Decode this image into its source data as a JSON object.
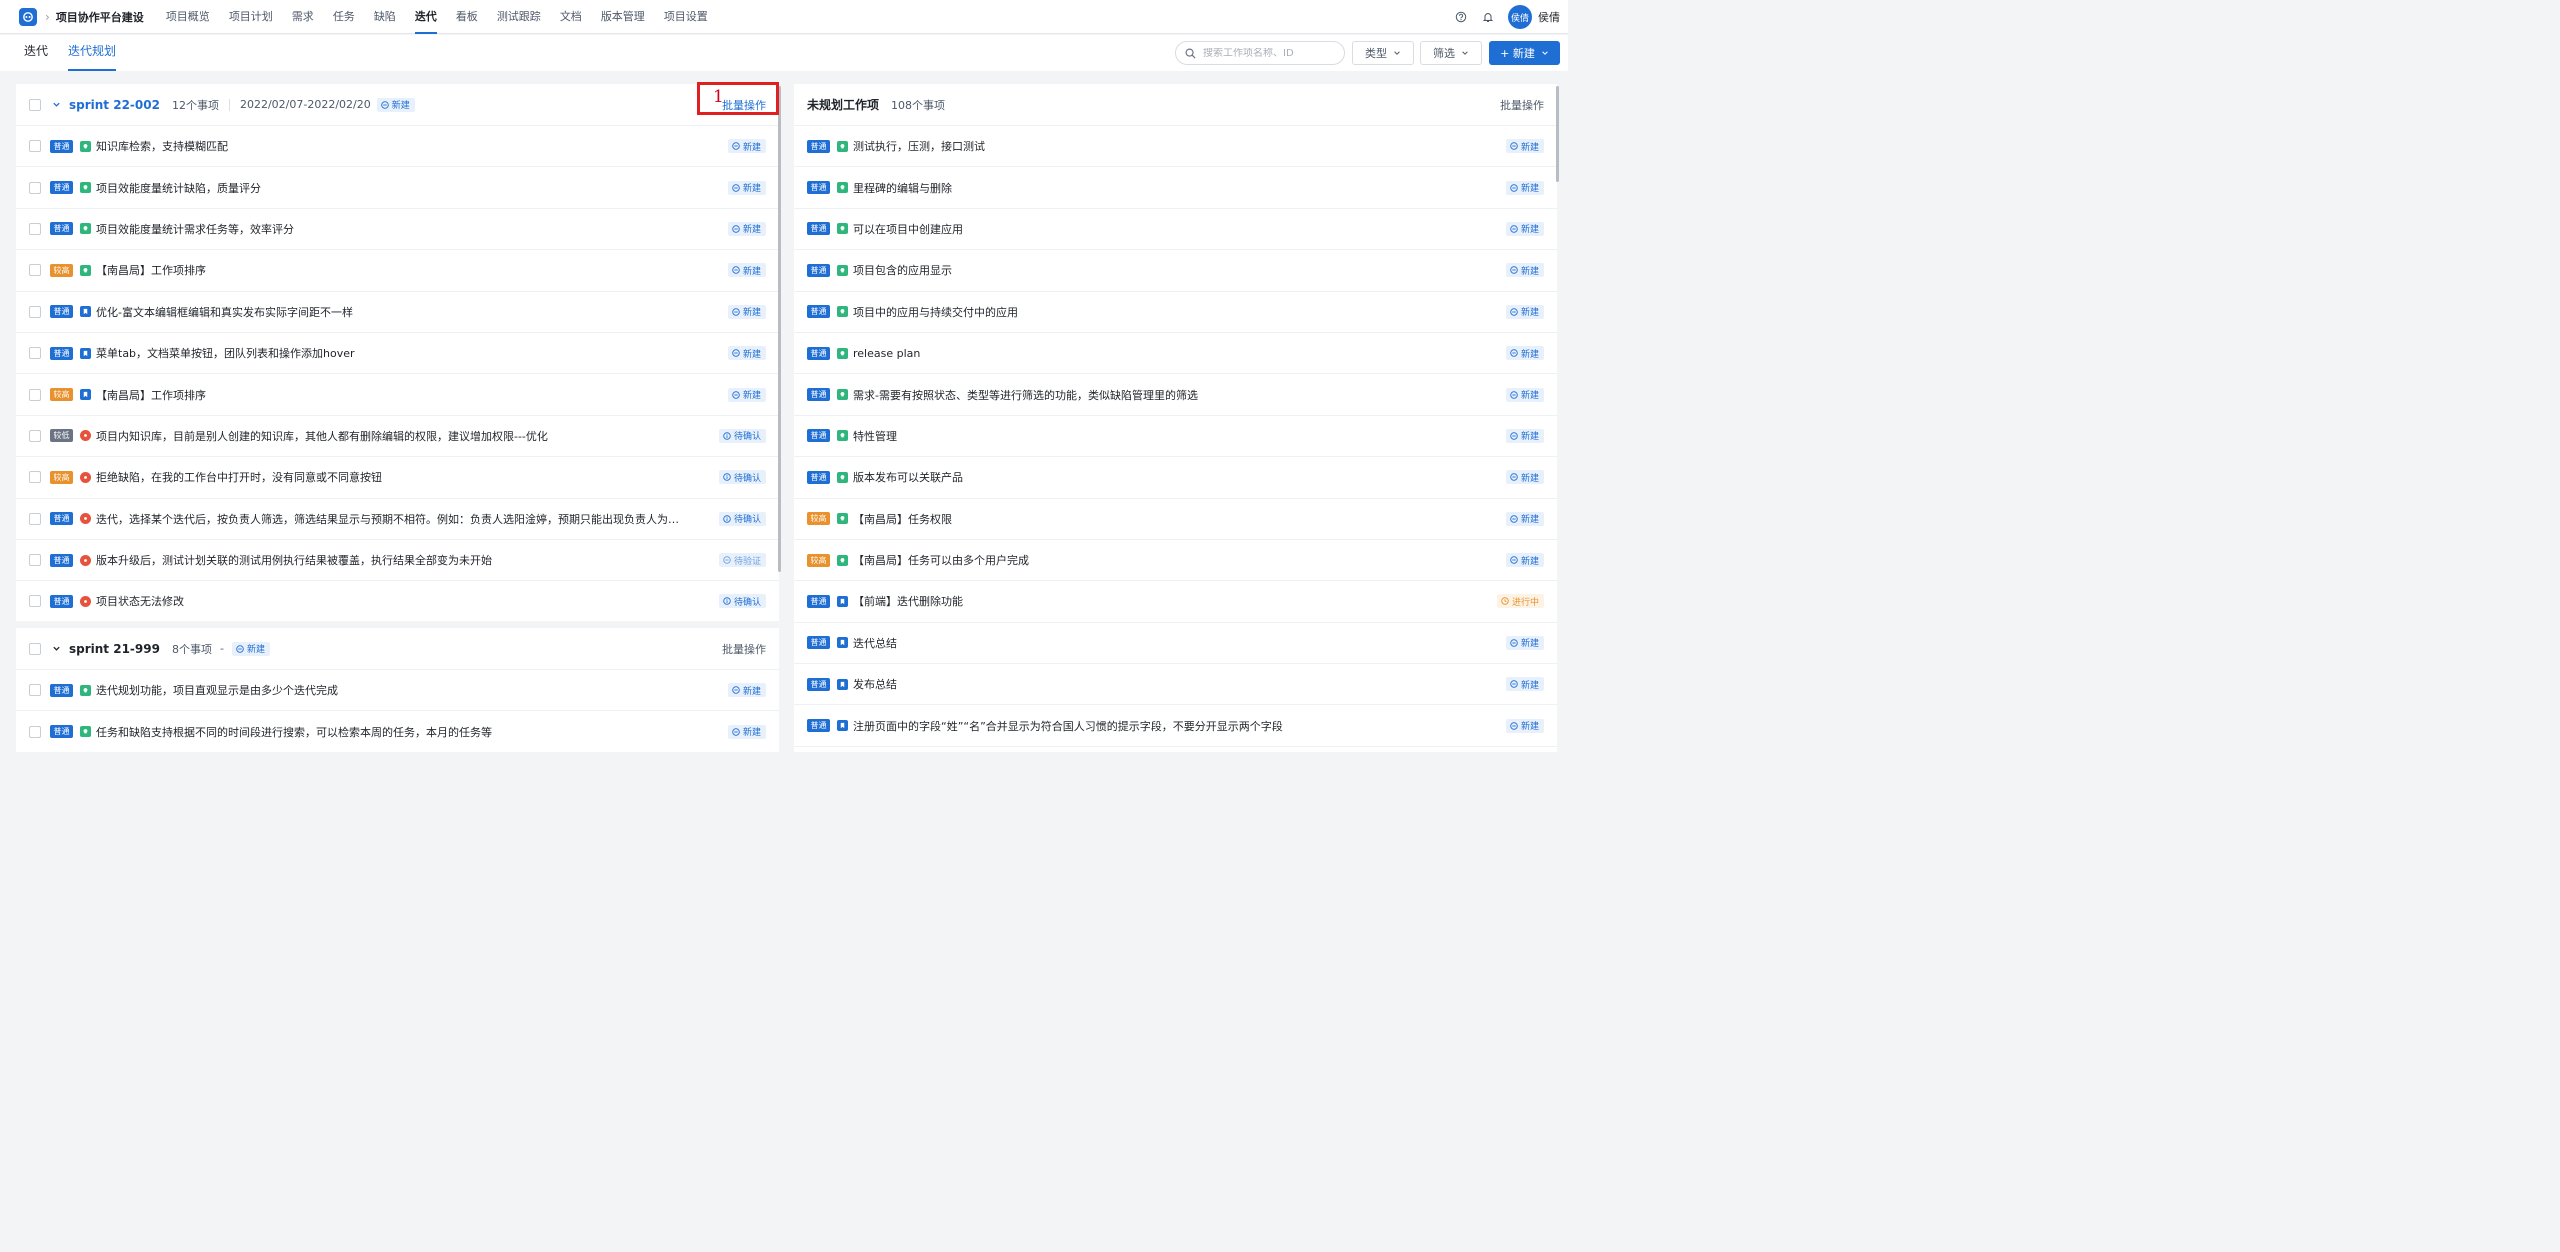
{
  "header": {
    "project_title": "项目协作平台建设",
    "nav": [
      "项目概览",
      "项目计划",
      "需求",
      "任务",
      "缺陷",
      "迭代",
      "看板",
      "测试跟踪",
      "文档",
      "版本管理",
      "项目设置"
    ],
    "active_nav": "迭代",
    "avatar_text": "侯倩",
    "user_name": "侯倩",
    "accent_color": "#1f6ed4"
  },
  "subnav": {
    "tabs": [
      "迭代",
      "迭代规划"
    ],
    "active_tab": "迭代规划",
    "search_placeholder": "搜索工作项名称、ID",
    "type_label": "类型",
    "filter_label": "筛选",
    "new_label": "+ 新建"
  },
  "sprints": [
    {
      "name": "sprint 22-002",
      "count": "12个事项",
      "dates": "2022/02/07-2022/02/20",
      "status": "新建",
      "batch": "批量操作",
      "items": [
        {
          "priority": "普通",
          "ptype": "normal",
          "itype": "req",
          "title": "知识库检索，支持模糊匹配",
          "status": "新建",
          "stype": "new"
        },
        {
          "priority": "普通",
          "ptype": "normal",
          "itype": "req",
          "title": "项目效能度量统计缺陷，质量评分",
          "status": "新建",
          "stype": "new"
        },
        {
          "priority": "普通",
          "ptype": "normal",
          "itype": "req",
          "title": "项目效能度量统计需求任务等，效率评分",
          "status": "新建",
          "stype": "new"
        },
        {
          "priority": "较高",
          "ptype": "high",
          "itype": "req",
          "title": "【南昌局】工作项排序",
          "status": "新建",
          "stype": "new"
        },
        {
          "priority": "普通",
          "ptype": "normal",
          "itype": "task",
          "title": "优化-富文本编辑框编辑和真实发布实际字间距不一样",
          "status": "新建",
          "stype": "new"
        },
        {
          "priority": "普通",
          "ptype": "normal",
          "itype": "task",
          "title": "菜单tab，文档菜单按钮，团队列表和操作添加hover",
          "status": "新建",
          "stype": "new"
        },
        {
          "priority": "较高",
          "ptype": "high",
          "itype": "task",
          "title": "【南昌局】工作项排序",
          "status": "新建",
          "stype": "new"
        },
        {
          "priority": "较低",
          "ptype": "low",
          "itype": "bug",
          "title": "项目内知识库，目前是别人创建的知识库，其他人都有删除编辑的权限，建议增加权限---优化",
          "status": "待确认",
          "stype": "confirm"
        },
        {
          "priority": "较高",
          "ptype": "high",
          "itype": "bug",
          "title": "拒绝缺陷，在我的工作台中打开时，没有同意或不同意按钮",
          "status": "待确认",
          "stype": "confirm"
        },
        {
          "priority": "普通",
          "ptype": "normal",
          "itype": "bug",
          "title": "迭代，选择某个迭代后，按负责人筛选，筛选结果显示与预期不相符。例如：负责人选阳淦婷，预期只能出现负责人为她，...",
          "status": "待确认",
          "stype": "confirm"
        },
        {
          "priority": "普通",
          "ptype": "normal",
          "itype": "bug",
          "title": "版本升级后，测试计划关联的测试用例执行结果被覆盖，执行结果全部变为未开始",
          "status": "待验证",
          "stype": "verify"
        },
        {
          "priority": "普通",
          "ptype": "normal",
          "itype": "bug",
          "title": "项目状态无法修改",
          "status": "待确认",
          "stype": "confirm"
        }
      ]
    },
    {
      "name": "sprint 21-999",
      "count": "8个事项",
      "dates": "-",
      "status": "新建",
      "batch": "批量操作",
      "items": [
        {
          "priority": "普通",
          "ptype": "normal",
          "itype": "req",
          "title": "迭代规划功能，项目直观显示是由多少个迭代完成",
          "status": "新建",
          "stype": "new"
        },
        {
          "priority": "普通",
          "ptype": "normal",
          "itype": "req",
          "title": "任务和缺陷支持根据不同的时间段进行搜索，可以检索本周的任务，本月的任务等",
          "status": "新建",
          "stype": "new"
        }
      ]
    }
  ],
  "annotation": {
    "number": "1"
  },
  "backlog": {
    "title": "未规划工作项",
    "count": "108个事项",
    "batch": "批量操作",
    "items": [
      {
        "priority": "普通",
        "ptype": "normal",
        "itype": "req",
        "title": "测试执行，压测，接口测试",
        "status": "新建",
        "stype": "new"
      },
      {
        "priority": "普通",
        "ptype": "normal",
        "itype": "req",
        "title": "里程碑的编辑与删除",
        "status": "新建",
        "stype": "new"
      },
      {
        "priority": "普通",
        "ptype": "normal",
        "itype": "req",
        "title": "可以在项目中创建应用",
        "status": "新建",
        "stype": "new"
      },
      {
        "priority": "普通",
        "ptype": "normal",
        "itype": "req",
        "title": "项目包含的应用显示",
        "status": "新建",
        "stype": "new"
      },
      {
        "priority": "普通",
        "ptype": "normal",
        "itype": "req",
        "title": "项目中的应用与持续交付中的应用",
        "status": "新建",
        "stype": "new"
      },
      {
        "priority": "普通",
        "ptype": "normal",
        "itype": "req",
        "title": "release plan",
        "status": "新建",
        "stype": "new"
      },
      {
        "priority": "普通",
        "ptype": "normal",
        "itype": "req",
        "title": "需求-需要有按照状态、类型等进行筛选的功能，类似缺陷管理里的筛选",
        "status": "新建",
        "stype": "new"
      },
      {
        "priority": "普通",
        "ptype": "normal",
        "itype": "req",
        "title": "特性管理",
        "status": "新建",
        "stype": "new"
      },
      {
        "priority": "普通",
        "ptype": "normal",
        "itype": "req",
        "title": "版本发布可以关联产品",
        "status": "新建",
        "stype": "new"
      },
      {
        "priority": "较高",
        "ptype": "high",
        "itype": "req",
        "title": "【南昌局】任务权限",
        "status": "新建",
        "stype": "new"
      },
      {
        "priority": "较高",
        "ptype": "high",
        "itype": "req",
        "title": "【南昌局】任务可以由多个用户完成",
        "status": "新建",
        "stype": "new"
      },
      {
        "priority": "普通",
        "ptype": "normal",
        "itype": "task",
        "title": "【前端】迭代删除功能",
        "status": "进行中",
        "stype": "progress"
      },
      {
        "priority": "普通",
        "ptype": "normal",
        "itype": "task",
        "title": "迭代总结",
        "status": "新建",
        "stype": "new"
      },
      {
        "priority": "普通",
        "ptype": "normal",
        "itype": "task",
        "title": "发布总结",
        "status": "新建",
        "stype": "new"
      },
      {
        "priority": "普通",
        "ptype": "normal",
        "itype": "task",
        "title": "注册页面中的字段“姓”“名”合并显示为符合国人习惯的提示字段，不要分开显示两个字段",
        "status": "新建",
        "stype": "new"
      }
    ]
  }
}
